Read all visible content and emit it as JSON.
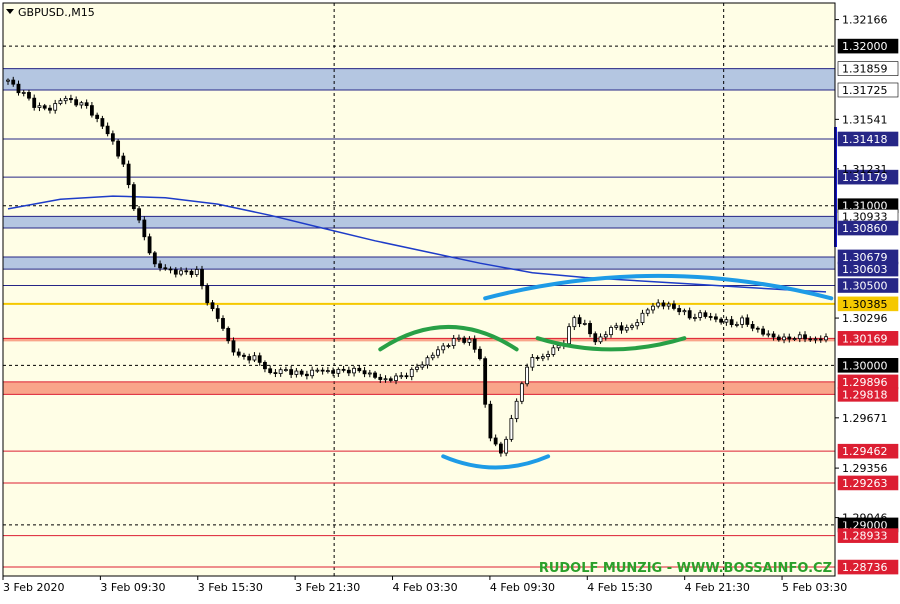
{
  "window": {
    "symbol_label": "GBPUSD.,M15",
    "watermark": "RUDOLF MUNZIG - WWW.BOSSAINFO.CZ"
  },
  "colors": {
    "plot_bg": "#fffee6",
    "axis_bg": "#ffffff",
    "support_zone": "#b4c6e1",
    "resistance_zone": "#f9a58a",
    "blue_line": "#262686",
    "red_line": "#dc1e32",
    "yellow_line": "#f5c800",
    "moving_average": "#1e3cc8",
    "arc_blue": "#1e9be6",
    "arc_green": "#28a046",
    "watermark": "#2aa02a",
    "candle": "#000000"
  },
  "chart_data": {
    "type": "candlestick",
    "symbol": "GBPUSD.",
    "timeframe": "M15",
    "ylim": [
      1.2868,
      1.3227
    ],
    "y_ticks": [
      "1.32166",
      "1.31541",
      "1.31231",
      "1.30296",
      "1.29671",
      "1.29356",
      "1.29046"
    ],
    "x_ticks": [
      "3 Feb 2020",
      "3 Feb 09:30",
      "3 Feb 15:30",
      "3 Feb 21:30",
      "4 Feb 03:30",
      "4 Feb 09:30",
      "4 Feb 15:30",
      "4 Feb 21:30",
      "5 Feb 03:30"
    ],
    "vertical_grid_at": [
      "3 Feb 21:30",
      "4 Feb 21:30"
    ],
    "price_levels": [
      {
        "price": "1.32000",
        "style": "dotted",
        "color": "black",
        "label_bg": "black"
      },
      {
        "price": "1.31859",
        "style": "solid",
        "color": "blue",
        "label_bg": "white"
      },
      {
        "price": "1.31725",
        "style": "solid",
        "color": "blue",
        "label_bg": "white"
      },
      {
        "price": "1.31418",
        "style": "solid",
        "color": "blue",
        "label_bg": "blue"
      },
      {
        "price": "1.31179",
        "style": "solid",
        "color": "blue",
        "label_bg": "blue"
      },
      {
        "price": "1.31000",
        "style": "dotted",
        "color": "black",
        "label_bg": "black"
      },
      {
        "price": "1.30933",
        "style": "solid",
        "color": "blue",
        "label_bg": "white"
      },
      {
        "price": "1.30860",
        "style": "solid",
        "color": "blue",
        "label_bg": "blue"
      },
      {
        "price": "1.30679",
        "style": "solid",
        "color": "blue",
        "label_bg": "blue"
      },
      {
        "price": "1.30603",
        "style": "solid",
        "color": "blue",
        "label_bg": "blue"
      },
      {
        "price": "1.30500",
        "style": "solid",
        "color": "blue",
        "label_bg": "blue"
      },
      {
        "price": "1.30385",
        "style": "solid",
        "color": "yellow",
        "label_bg": "yellow"
      },
      {
        "price": "1.30169",
        "style": "solid",
        "color": "red",
        "label_bg": "red"
      },
      {
        "price": "1.30000",
        "style": "dotted",
        "color": "black",
        "label_bg": "black"
      },
      {
        "price": "1.29896",
        "style": "solid",
        "color": "red",
        "label_bg": "red"
      },
      {
        "price": "1.29818",
        "style": "solid",
        "color": "red",
        "label_bg": "red"
      },
      {
        "price": "1.29462",
        "style": "solid",
        "color": "red",
        "label_bg": "red"
      },
      {
        "price": "1.29263",
        "style": "solid",
        "color": "red",
        "label_bg": "red"
      },
      {
        "price": "1.29000",
        "style": "dotted",
        "color": "black",
        "label_bg": "black"
      },
      {
        "price": "1.28933",
        "style": "solid",
        "color": "red",
        "label_bg": "red"
      },
      {
        "price": "1.28736",
        "style": "solid",
        "color": "red",
        "label_bg": "red"
      }
    ],
    "zones": [
      {
        "from": 1.31725,
        "to": 1.31859,
        "type": "support"
      },
      {
        "from": 1.3086,
        "to": 1.30933,
        "type": "support"
      },
      {
        "from": 1.30603,
        "to": 1.30679,
        "type": "support"
      },
      {
        "from": 1.3015,
        "to": 1.30169,
        "type": "resistance"
      },
      {
        "from": 1.29818,
        "to": 1.29896,
        "type": "resistance"
      }
    ],
    "price_path": [
      [
        0,
        1.3178
      ],
      [
        3,
        1.317
      ],
      [
        5,
        1.3163
      ],
      [
        8,
        1.316
      ],
      [
        10,
        1.3167
      ],
      [
        13,
        1.3165
      ],
      [
        15,
        1.3162
      ],
      [
        18,
        1.315
      ],
      [
        20,
        1.314
      ],
      [
        22,
        1.3125
      ],
      [
        24,
        1.31
      ],
      [
        26,
        1.308
      ],
      [
        28,
        1.3063
      ],
      [
        30,
        1.306
      ],
      [
        33,
        1.3058
      ],
      [
        36,
        1.3059
      ],
      [
        38,
        1.304
      ],
      [
        40,
        1.303
      ],
      [
        42,
        1.3015
      ],
      [
        44,
        1.3005
      ],
      [
        47,
        1.3005
      ],
      [
        50,
        1.2995
      ],
      [
        53,
        1.2997
      ],
      [
        56,
        1.2994
      ],
      [
        59,
        1.2997
      ],
      [
        62,
        1.2996
      ],
      [
        65,
        1.2997
      ],
      [
        68,
        1.2996
      ],
      [
        71,
        1.2991
      ],
      [
        74,
        1.2992
      ],
      [
        77,
        1.2996
      ],
      [
        80,
        1.3004
      ],
      [
        83,
        1.3012
      ],
      [
        86,
        1.3017
      ],
      [
        88,
        1.3015
      ],
      [
        90,
        1.3005
      ],
      [
        91,
        1.2975
      ],
      [
        92,
        1.2955
      ],
      [
        94,
        1.2945
      ],
      [
        96,
        1.2965
      ],
      [
        98,
        1.299
      ],
      [
        100,
        1.3005
      ],
      [
        102,
        1.3005
      ],
      [
        104,
        1.301
      ],
      [
        106,
        1.3015
      ],
      [
        108,
        1.303
      ],
      [
        110,
        1.3025
      ],
      [
        112,
        1.3015
      ],
      [
        114,
        1.302
      ],
      [
        116,
        1.3025
      ],
      [
        118,
        1.3022
      ],
      [
        120,
        1.3028
      ],
      [
        122,
        1.3035
      ],
      [
        124,
        1.3039
      ],
      [
        126,
        1.3037
      ],
      [
        128,
        1.3035
      ],
      [
        130,
        1.303
      ],
      [
        132,
        1.3032
      ],
      [
        134,
        1.303
      ],
      [
        136,
        1.3028
      ],
      [
        138,
        1.3026
      ],
      [
        140,
        1.3028
      ],
      [
        142,
        1.3024
      ],
      [
        144,
        1.302
      ],
      [
        146,
        1.3018
      ],
      [
        148,
        1.3016
      ],
      [
        150,
        1.3018
      ],
      [
        152,
        1.3017
      ],
      [
        154,
        1.3016
      ],
      [
        156,
        1.3017
      ]
    ],
    "moving_average": [
      [
        0,
        1.3098
      ],
      [
        10,
        1.3104
      ],
      [
        20,
        1.3106
      ],
      [
        30,
        1.3105
      ],
      [
        40,
        1.3101
      ],
      [
        50,
        1.3094
      ],
      [
        60,
        1.3086
      ],
      [
        70,
        1.3078
      ],
      [
        80,
        1.3071
      ],
      [
        90,
        1.3064
      ],
      [
        100,
        1.3058
      ],
      [
        110,
        1.3055
      ],
      [
        120,
        1.3053
      ],
      [
        130,
        1.3051
      ],
      [
        140,
        1.3049
      ],
      [
        150,
        1.3047
      ],
      [
        156,
        1.3046
      ]
    ],
    "annotations": [
      {
        "type": "arc",
        "direction": "cap",
        "color": "green",
        "center_index": 84,
        "span": 13,
        "price": 1.301
      },
      {
        "type": "arc",
        "direction": "cup",
        "color": "blue",
        "center_index": 93,
        "span": 10,
        "price": 1.2943
      },
      {
        "type": "arc",
        "direction": "cap",
        "color": "blue",
        "center_index": 124,
        "span": 33,
        "price": 1.3042
      },
      {
        "type": "arc",
        "direction": "cup",
        "color": "green",
        "center_index": 115,
        "span": 14,
        "price": 1.3017
      }
    ]
  }
}
